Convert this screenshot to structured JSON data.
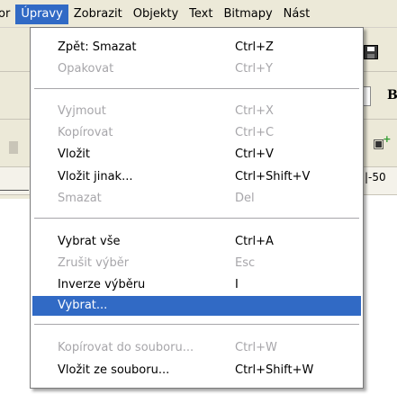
{
  "menubar": {
    "items": [
      {
        "label": "or",
        "active": false
      },
      {
        "label": "Úpravy",
        "active": true
      },
      {
        "label": "Zobrazit",
        "active": false
      },
      {
        "label": "Objekty",
        "active": false
      },
      {
        "label": "Text",
        "active": false
      },
      {
        "label": "Bitmapy",
        "active": false
      },
      {
        "label": "Nást",
        "active": false
      }
    ]
  },
  "background": {
    "ruler_label": "|-50",
    "bold_button_label": "B"
  },
  "edit_menu": {
    "items": [
      {
        "label": "Zpět: Smazat",
        "shortcut": "Ctrl+Z",
        "disabled": false
      },
      {
        "label": "Opakovat",
        "shortcut": "Ctrl+Y",
        "disabled": true
      },
      {
        "label": "Vyjmout",
        "shortcut": "Ctrl+X",
        "disabled": true
      },
      {
        "label": "Kopírovat",
        "shortcut": "Ctrl+C",
        "disabled": true
      },
      {
        "label": "Vložit",
        "shortcut": "Ctrl+V",
        "disabled": false
      },
      {
        "label": "Vložit jinak...",
        "shortcut": "Ctrl+Shift+V",
        "disabled": false
      },
      {
        "label": "Smazat",
        "shortcut": "Del",
        "disabled": true
      },
      {
        "label": "Vybrat vše",
        "shortcut": "Ctrl+A",
        "disabled": false
      },
      {
        "label": "Zrušit výběr",
        "shortcut": "Esc",
        "disabled": true
      },
      {
        "label": "Inverze výběru",
        "shortcut": "I",
        "disabled": false
      },
      {
        "label": "Vybrat...",
        "shortcut": "",
        "disabled": false,
        "highlighted": true
      },
      {
        "label": "Kopírovat do souboru...",
        "shortcut": "Ctrl+W",
        "disabled": true
      },
      {
        "label": "Vložit ze souboru...",
        "shortcut": "Ctrl+Shift+W",
        "disabled": false
      }
    ]
  },
  "colors": {
    "highlight": "#316ac5",
    "disabled_text": "#a7a6aa",
    "menubar_bg": "#ece9d8"
  }
}
